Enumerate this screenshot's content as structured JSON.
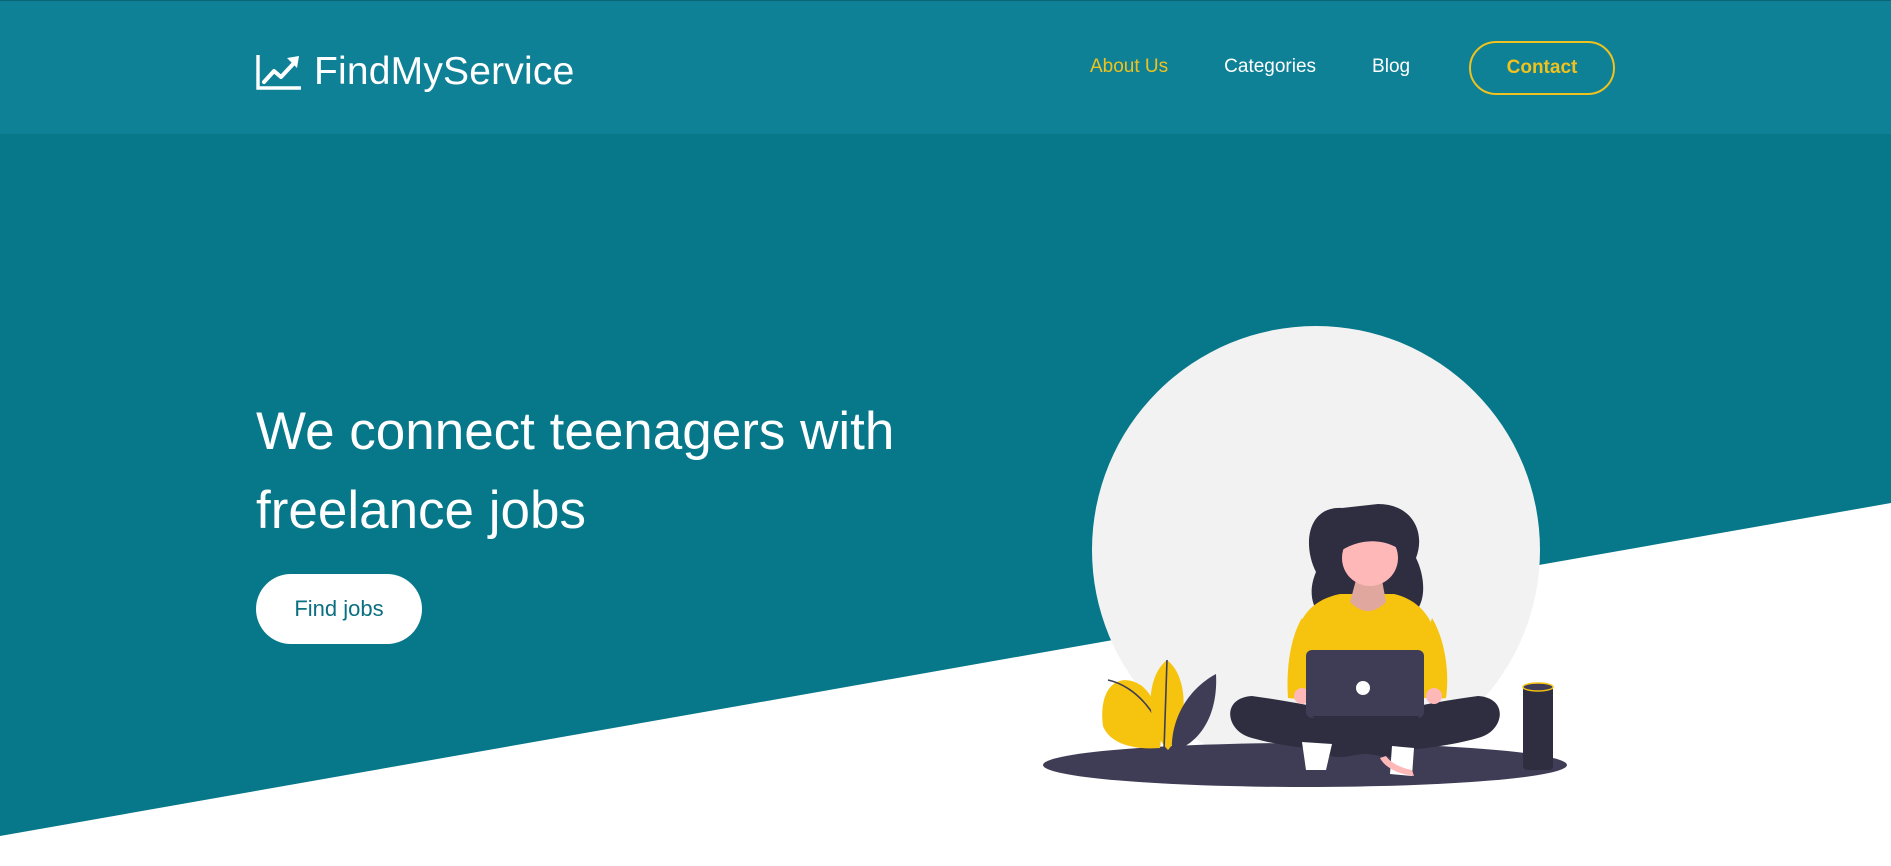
{
  "colors": {
    "hero_bg": "#06788a",
    "navbar_bg": "#0e8196",
    "accent": "#f0c21d",
    "white": "#ffffff"
  },
  "brand": {
    "name": "FindMyService",
    "icon": "trending-up-chart-icon"
  },
  "nav": {
    "items": [
      {
        "label": "About Us",
        "active": true
      },
      {
        "label": "Categories",
        "active": false
      },
      {
        "label": "Blog",
        "active": false
      }
    ],
    "contact_label": "Contact"
  },
  "hero": {
    "title": "We connect teenagers with freelance jobs",
    "cta_label": "Find jobs"
  }
}
